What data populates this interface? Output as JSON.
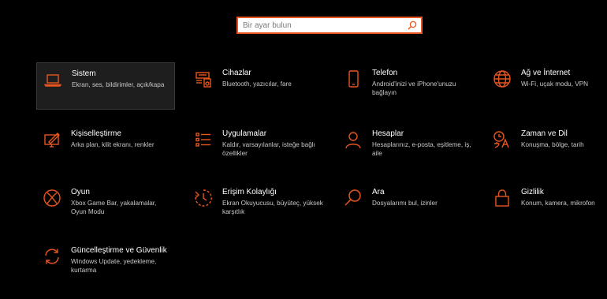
{
  "search": {
    "placeholder": "Bir ayar bulun"
  },
  "accent_color": "#e8551f",
  "tiles": [
    {
      "icon": "laptop-icon",
      "title": "Sistem",
      "desc": "Ekran, ses, bildirimler, açık/kapa"
    },
    {
      "icon": "devices-icon",
      "title": "Cihazlar",
      "desc": "Bluetooth, yazıcılar, fare"
    },
    {
      "icon": "phone-icon",
      "title": "Telefon",
      "desc": "Android'inizi ve iPhone'unuzu bağlayın"
    },
    {
      "icon": "globe-icon",
      "title": "Ağ ve İnternet",
      "desc": "Wi-Fi, uçak modu, VPN"
    },
    {
      "icon": "paint-icon",
      "title": "Kişiselleştirme",
      "desc": "Arka plan, kilit ekranı, renkler"
    },
    {
      "icon": "apps-list-icon",
      "title": "Uygulamalar",
      "desc": "Kaldır, varsayılanlar, isteğe bağlı özellikler"
    },
    {
      "icon": "person-icon",
      "title": "Hesaplar",
      "desc": "Hesaplarınız, e-posta, eşitleme, iş, aile"
    },
    {
      "icon": "time-language-icon",
      "title": "Zaman ve Dil",
      "desc": "Konuşma, bölge, tarih"
    },
    {
      "icon": "xbox-icon",
      "title": "Oyun",
      "desc": "Xbox Game Bar, yakalamalar, Oyun Modu"
    },
    {
      "icon": "ease-of-access-icon",
      "title": "Erişim Kolaylığı",
      "desc": "Ekran Okuyucusu, büyüteç, yüksek karşıtlık"
    },
    {
      "icon": "search-icon",
      "title": "Ara",
      "desc": "Dosyalarımı bul, izinler"
    },
    {
      "icon": "lock-icon",
      "title": "Gizlilik",
      "desc": "Konum, kamera, mikrofon"
    },
    {
      "icon": "update-icon",
      "title": "Güncelleştirme ve Güvenlik",
      "desc": "Windows Update, yedekleme, kurtarma"
    }
  ]
}
